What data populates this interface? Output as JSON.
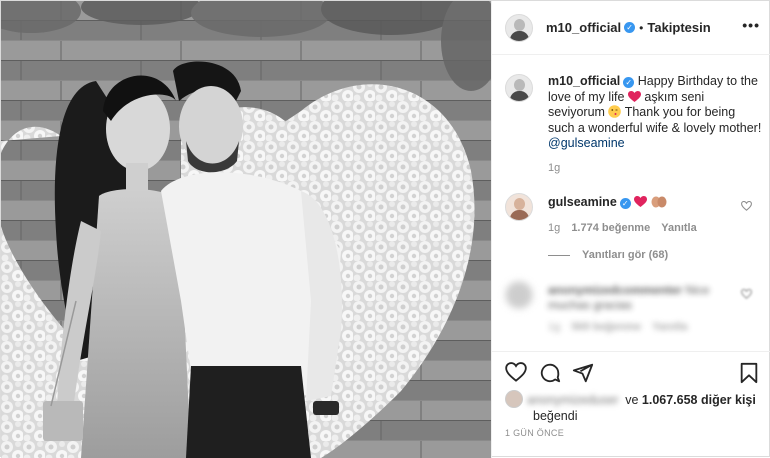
{
  "post": {
    "username": "m10_official",
    "separator": "•",
    "follow_status": "Takiptesin",
    "more": "•••"
  },
  "caption": {
    "username": "m10_official",
    "text_part1": "Happy Birthday to the love of my life",
    "text_part2": "aşkım seni seviyorum",
    "text_part3": "Thank you for being such a wonderful wife & lovely mother!",
    "mention": "@gulseamine",
    "time": "1g"
  },
  "comments": [
    {
      "username": "gulseamine",
      "time": "1g",
      "likes": "1.774 beğenme",
      "reply": "Yanıtla"
    },
    {
      "username": "anonymizedcommenter",
      "text": "Nice muchas gracias",
      "time": "1g",
      "likes": "569 beğenme",
      "reply": "Yanıtla"
    }
  ],
  "view_replies": "Yanıtları gör (68)",
  "likes": {
    "liked_by": "anonymizeduser",
    "and": "ve",
    "count": "1.067.658 diğer kişi",
    "liked": "beğendi"
  },
  "timestamp": "1 GÜN ÖNCE",
  "colors": {
    "verified": "#3897f0",
    "heart": "#ed4956",
    "mention": "#00376b",
    "secondary_text": "#8e8e8e"
  },
  "icons": [
    "verified-badge-icon",
    "more-options-icon",
    "heart-icon",
    "comment-icon",
    "share-icon",
    "bookmark-icon"
  ]
}
